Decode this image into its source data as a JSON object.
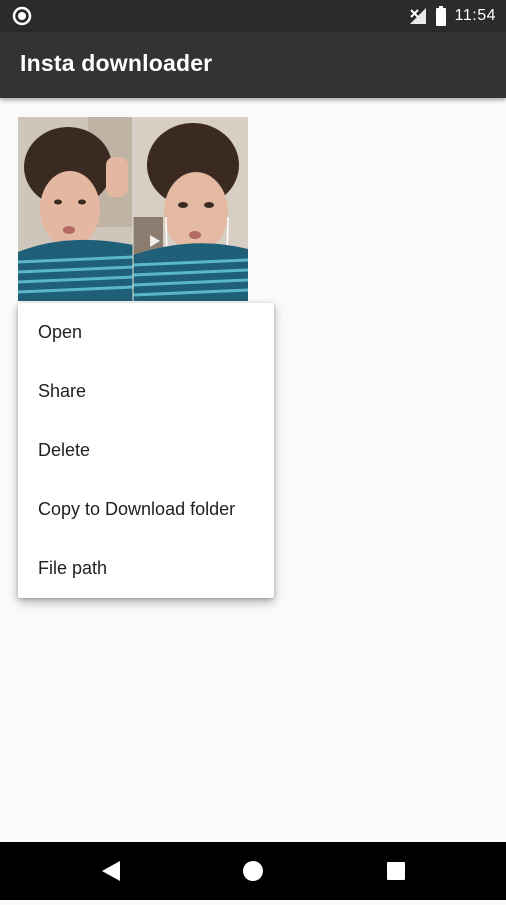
{
  "status_bar": {
    "time": "11:54",
    "left_icon": "circle-notification-icon",
    "signal_icon": "no-signal-icon",
    "battery_icon": "battery-icon"
  },
  "app_bar": {
    "title": "Insta downloader",
    "background": "#333333"
  },
  "media": {
    "thumbnail_icon": "video-thumbnail"
  },
  "context_menu": {
    "items": [
      {
        "label": "Open"
      },
      {
        "label": "Share"
      },
      {
        "label": "Delete"
      },
      {
        "label": "Copy to Download folder"
      },
      {
        "label": "File path"
      }
    ]
  },
  "nav_bar": {
    "back_icon": "back-triangle-icon",
    "home_icon": "home-circle-icon",
    "recents_icon": "recents-square-icon"
  }
}
